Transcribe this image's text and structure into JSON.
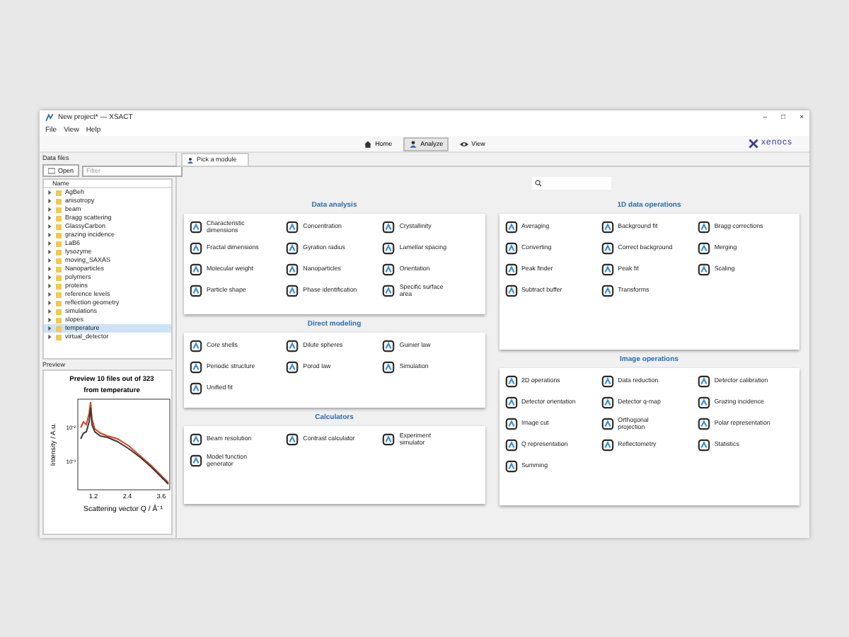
{
  "window": {
    "title": "New project* — XSACT",
    "controls": [
      "–",
      "□",
      "×"
    ]
  },
  "menu": [
    "File",
    "View",
    "Help"
  ],
  "toolbar": [
    {
      "label": "Home",
      "selected": false
    },
    {
      "label": "Analyze",
      "selected": true
    },
    {
      "label": "View",
      "selected": false
    }
  ],
  "logo": "xenocs",
  "data_files": {
    "title": "Data files",
    "open_button": "Open",
    "filter_placeholder": "Filter",
    "column": "Name",
    "items": [
      {
        "name": "AgBeh",
        "selected": false,
        "expanded": false
      },
      {
        "name": "anisotropy",
        "selected": false,
        "expanded": false
      },
      {
        "name": "beam",
        "selected": false,
        "expanded": false
      },
      {
        "name": "Bragg scattering",
        "selected": false,
        "expanded": false
      },
      {
        "name": "GlassyCarbon",
        "selected": false,
        "expanded": false
      },
      {
        "name": "grazing incidence",
        "selected": false,
        "expanded": false
      },
      {
        "name": "LaB6",
        "selected": false,
        "expanded": false
      },
      {
        "name": "lysozyme",
        "selected": false,
        "expanded": false
      },
      {
        "name": "moving_SAXAS",
        "selected": false,
        "expanded": false
      },
      {
        "name": "Nanoparticles",
        "selected": false,
        "expanded": false
      },
      {
        "name": "polymers",
        "selected": false,
        "expanded": false
      },
      {
        "name": "proteins",
        "selected": false,
        "expanded": false
      },
      {
        "name": "reference levels",
        "selected": false,
        "expanded": false
      },
      {
        "name": "reflection geometry",
        "selected": false,
        "expanded": false
      },
      {
        "name": "simulations",
        "selected": false,
        "expanded": false
      },
      {
        "name": "slopes",
        "selected": false,
        "expanded": false
      },
      {
        "name": "temperature",
        "selected": true,
        "expanded": false
      },
      {
        "name": "virtual_detector",
        "selected": false,
        "expanded": false
      }
    ]
  },
  "preview": {
    "title": "Preview",
    "heading": "Preview 10 files out of 323",
    "subheading": "from temperature",
    "xlabel": "Scattering vector Q / Å⁻¹",
    "ylabel": "Intensity / A.u.",
    "x_tick_labels": [
      "1.2",
      "2.4",
      "3.6"
    ],
    "y_tick_labels": [
      "10⁻²",
      "10⁻³"
    ]
  },
  "tabs": [
    {
      "label": "Pick a module",
      "selected": true
    }
  ],
  "left_sections": [
    {
      "title": "Data analysis",
      "items": [
        "Characteristic dimensions",
        "Concentration",
        "Crystallinity",
        "Fractal dimensions",
        "Gyration radius",
        "Lamellar spacing",
        "Molecular weight",
        "Nanoparticles",
        "Orientation",
        "Particle shape",
        "Phase identification",
        "Specific surface area"
      ]
    },
    {
      "title": "Direct modeling",
      "items": [
        "Core shells",
        "Dilute spheres",
        "Guinier law",
        "Periodic structure",
        "Porod law",
        "Simulation",
        "Unified fit"
      ]
    },
    {
      "title": "Calculators",
      "items": [
        "Beam resolution",
        "Contrast calculator",
        "Experiment simulator",
        "Model function generator"
      ]
    }
  ],
  "right_sections": [
    {
      "title": "1D data operations",
      "items": [
        "Averaging",
        "Background fit",
        "Bragg corrections",
        "Converting",
        "Correct background",
        "Merging",
        "Peak finder",
        "Peak fit",
        "Scaling",
        "Subtract buffer",
        "Transforms"
      ]
    },
    {
      "title": "Image operations",
      "items": [
        "2D operations",
        "Data reduction",
        "Detector calibration",
        "Detector orientation",
        "Detector q-map",
        "Grazing incidence",
        "Image cut",
        "Orthogonal projection",
        "Polar representation",
        "Q representation",
        "Reflectometry",
        "Statistics",
        "Summing"
      ]
    }
  ]
}
